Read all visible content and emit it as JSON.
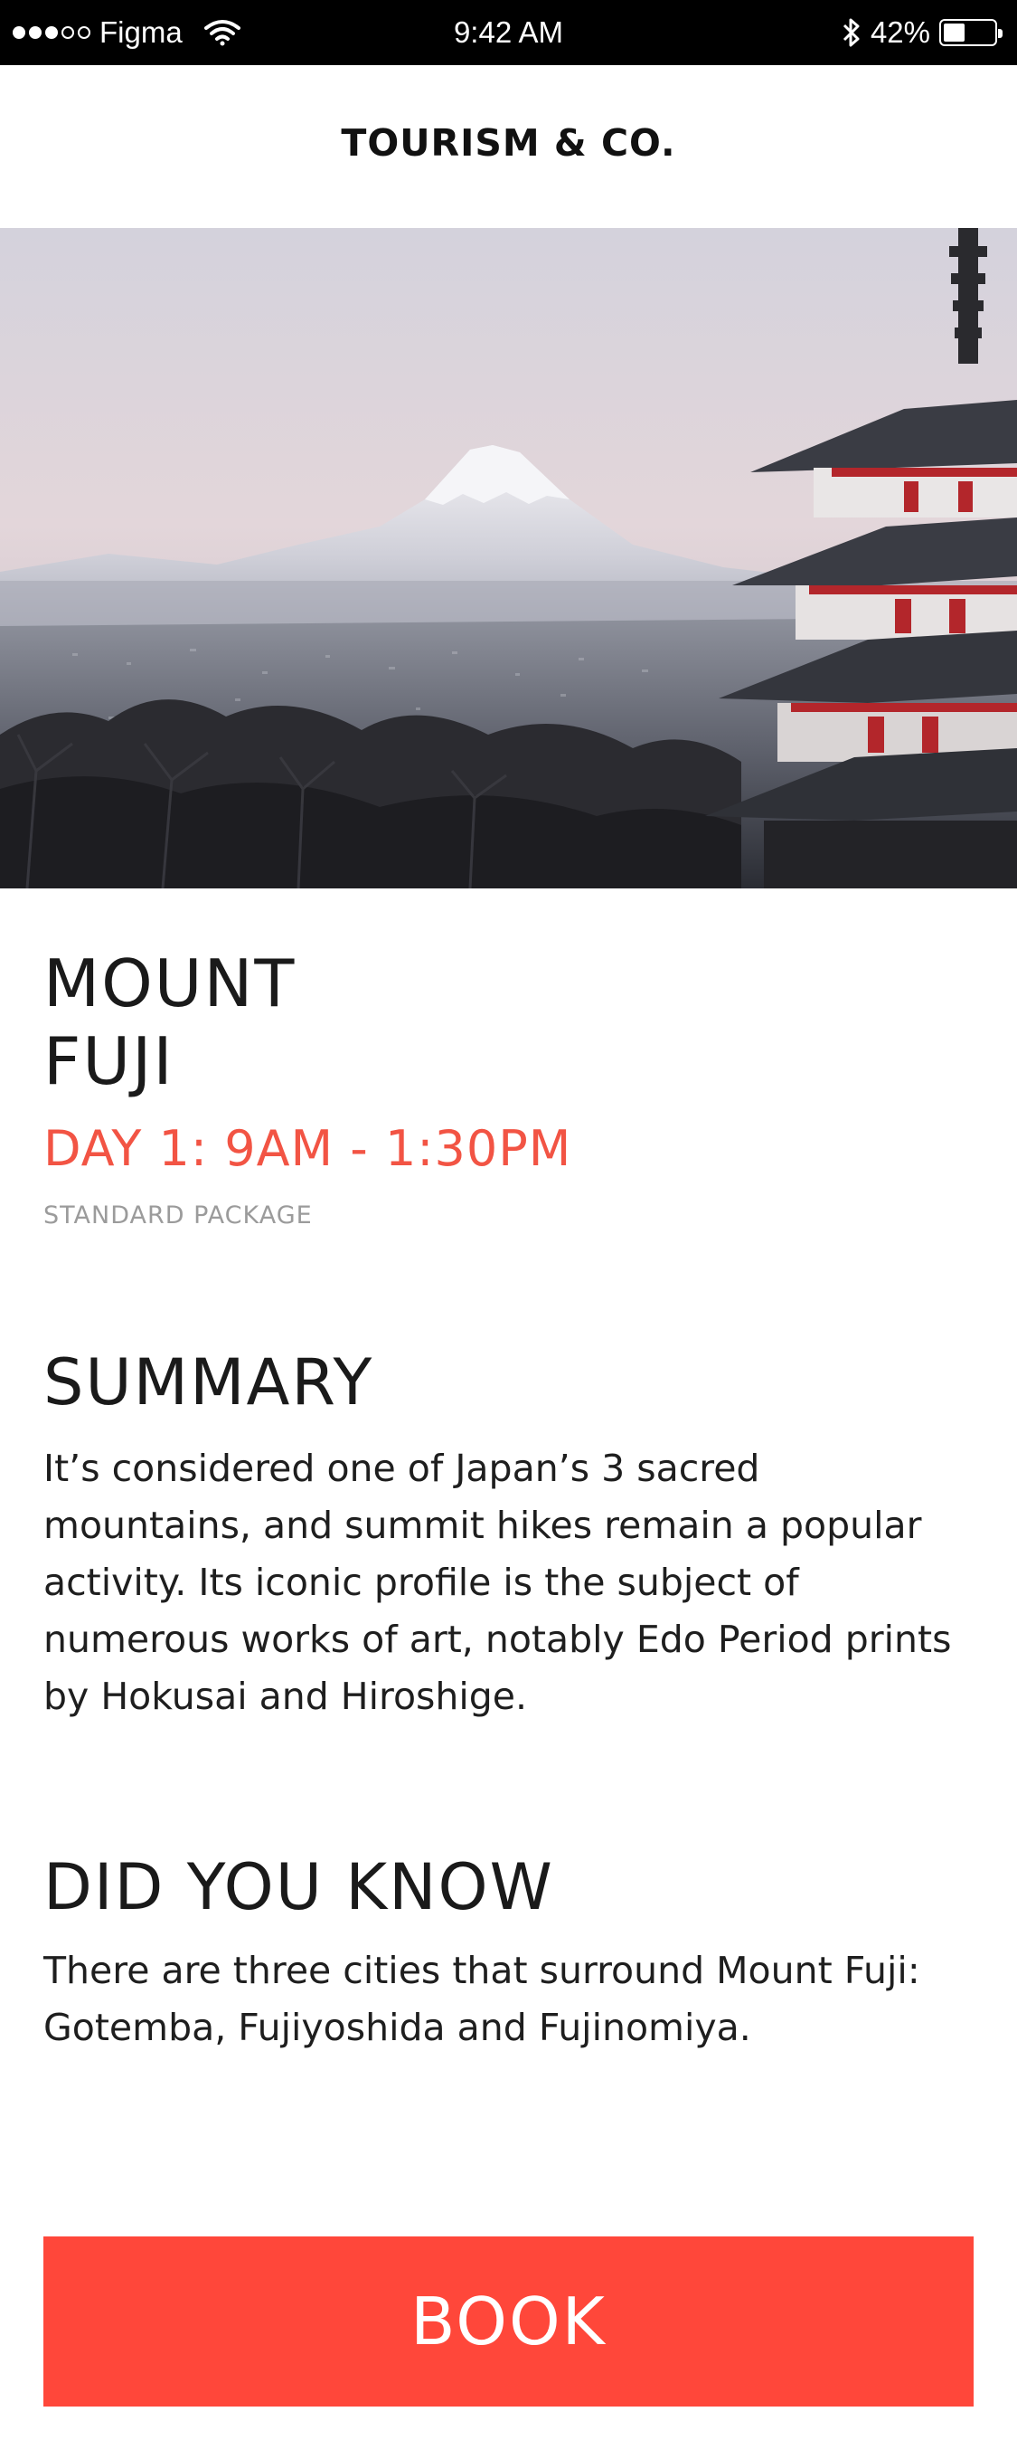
{
  "status_bar": {
    "carrier": "Figma",
    "time": "9:42 AM",
    "battery_pct": "42%",
    "battery_level": 0.42,
    "signal_bars_filled": 3,
    "signal_bars_total": 5,
    "icons": [
      "wifi-icon",
      "bluetooth-icon",
      "battery-icon"
    ]
  },
  "header": {
    "brand": "TOURISM & CO."
  },
  "hero": {
    "image": "mount-fuji-pagoda-photo"
  },
  "tour": {
    "title_line1": "MOUNT",
    "title_line2": "FUJI",
    "schedule": "DAY 1: 9AM - 1:30PM",
    "package": "STANDARD PACKAGE"
  },
  "summary": {
    "heading": "SUMMARY",
    "text": "It’s considered one of Japan’s 3 sacred mountains, and summit hikes remain a popular activity. Its iconic profile is the subject of numerous works of art, notably Edo Period prints by Hokusai and Hiroshige."
  },
  "did_you_know": {
    "heading": "DID YOU KNOW",
    "text": "There are three cities that surround Mount Fuji: Gotemba, Fujiyoshida and Fujinomiya."
  },
  "actions": {
    "book_label": "BOOK"
  },
  "colors": {
    "accent": "#f25444",
    "button": "#ff473a",
    "muted": "#9b9b9b",
    "status_bar_bg": "#000000"
  }
}
